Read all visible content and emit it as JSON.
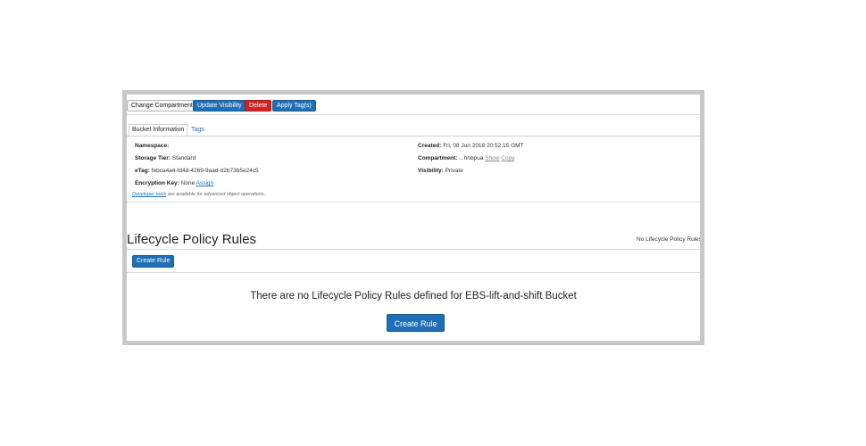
{
  "toolbar": {
    "change_compartment": "Change Compartment",
    "update_visibility": "Update Visibility",
    "delete": "Delete",
    "apply_tags": "Apply Tag(s)"
  },
  "tabs": [
    {
      "label": "Bucket Information",
      "active": true
    },
    {
      "label": "Tags",
      "active": false
    }
  ],
  "info": {
    "namespace": {
      "label": "Namespace:",
      "value": ""
    },
    "storage_tier": {
      "label": "Storage Tier:",
      "value": "Standard"
    },
    "etag": {
      "label": "eTag:",
      "value": "febca4a4-fd4d-4269-9aad-d2b73b5e24c5"
    },
    "encryption_key": {
      "label": "Encryption Key:",
      "value": "None",
      "link": "Assign"
    },
    "created": {
      "label": "Created:",
      "value": "Fri, 08 Jun 2018 20:52:15 GMT"
    },
    "compartment": {
      "label": "Compartment:",
      "value": "...hnbpua",
      "show": "Show",
      "copy": "Copy"
    },
    "visibility": {
      "label": "Visibility:",
      "value": "Private"
    }
  },
  "dev_note": {
    "link": "Developer tools",
    "text": " are available for advanced object operations."
  },
  "lifecycle": {
    "title": "Lifecycle Policy Rules",
    "side_note": "No Lifecycle Policy Rules",
    "create_rule": "Create Rule",
    "empty_message": "There are no Lifecycle Policy Rules defined for EBS-lift-and-shift Bucket",
    "create_rule_big": "Create Rule"
  },
  "colors": {
    "primary": "#1e6fb8",
    "danger": "#d12323",
    "frame_border": "#c8c8c8"
  }
}
